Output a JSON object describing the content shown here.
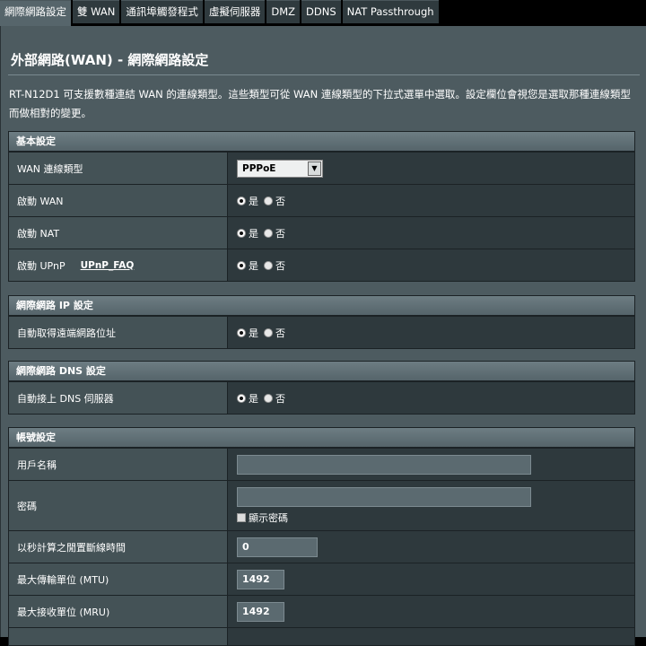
{
  "tabs": [
    {
      "label": "網際網路設定",
      "active": true
    },
    {
      "label": "雙 WAN",
      "active": false
    },
    {
      "label": "通訊埠觸發程式",
      "active": false
    },
    {
      "label": "虛擬伺服器",
      "active": false
    },
    {
      "label": "DMZ",
      "active": false
    },
    {
      "label": "DDNS",
      "active": false
    },
    {
      "label": "NAT Passthrough",
      "active": false
    }
  ],
  "page": {
    "title": "外部網路(WAN) - 網際網路設定",
    "description": "RT-N12D1 可支援數種連結 WAN 的連線類型。這些類型可從 WAN 連線類型的下拉式選單中選取。設定欄位會視您是選取那種連線類型而做相對的變更。"
  },
  "radio_labels": {
    "yes": "是",
    "no": "否"
  },
  "basic": {
    "header": "基本設定",
    "wan_type_label": "WAN 連線類型",
    "wan_type_value": "PPPoE",
    "enable_wan_label": "啟動 WAN",
    "enable_nat_label": "啟動 NAT",
    "enable_upnp_label": "啟動 UPnP",
    "upnp_faq": "UPnP_FAQ"
  },
  "ip": {
    "header": "網際網路 IP 設定",
    "auto_ip_label": "自動取得遠端網路位址"
  },
  "dns": {
    "header": "網際網路 DNS 設定",
    "auto_dns_label": "自動接上 DNS 伺服器"
  },
  "account": {
    "header": "帳號設定",
    "username_label": "用戶名稱",
    "username_value": "",
    "password_label": "密碼",
    "password_value": "",
    "show_password_label": "顯示密碼",
    "idle_label": "以秒計算之閒置斷線時間",
    "idle_value": "0",
    "mtu_label": "最大傳輸單位 (MTU)",
    "mtu_value": "1492",
    "mru_label": "最大接收單位 (MRU)",
    "mru_value": "1492"
  }
}
